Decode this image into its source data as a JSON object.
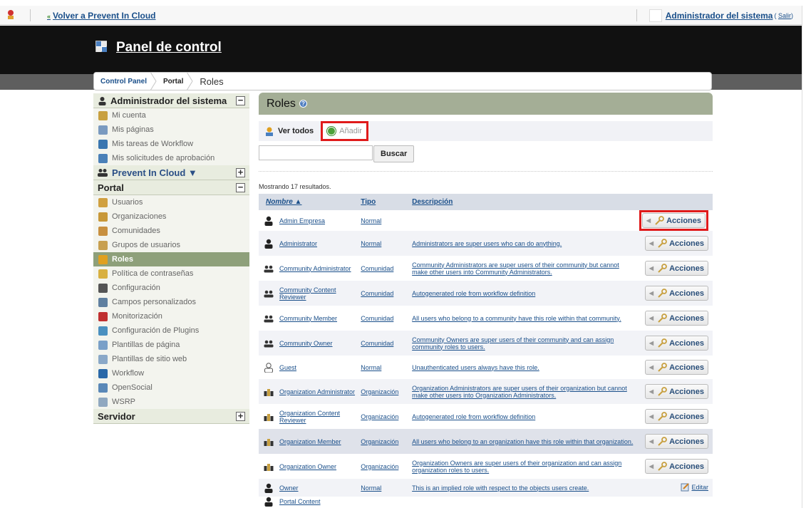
{
  "dockbar": {
    "back_arrow": "«",
    "back_label": "Volver a Prevent In Cloud",
    "user_name": "Administrador del sistema",
    "logout_prefix": "(",
    "logout_label": "Salir",
    "logout_suffix": ")"
  },
  "header": {
    "title": "Panel de control"
  },
  "breadcrumb": [
    "Control Panel",
    "Portal",
    "Roles"
  ],
  "sidebar": {
    "user_section": "Administrador del sistema",
    "user_items": [
      {
        "label": "Mi cuenta",
        "icon": "account-icon",
        "color": "#c8a040"
      },
      {
        "label": "Mis páginas",
        "icon": "pages-icon",
        "color": "#7a9ac0"
      },
      {
        "label": "Mis tareas de Workflow",
        "icon": "workflow-tasks-icon",
        "color": "#3a76b0"
      },
      {
        "label": "Mis solicitudes de aprobación",
        "icon": "approval-icon",
        "color": "#4a80b8"
      }
    ],
    "site_section": "Prevent In Cloud ▼",
    "portal_section": "Portal",
    "portal_items": [
      {
        "label": "Usuarios",
        "icon": "users-icon",
        "color": "#d0a040"
      },
      {
        "label": "Organizaciones",
        "icon": "organizations-icon",
        "color": "#c89838"
      },
      {
        "label": "Comunidades",
        "icon": "communities-icon",
        "color": "#c89040"
      },
      {
        "label": "Grupos de usuarios",
        "icon": "user-groups-icon",
        "color": "#c8a050"
      },
      {
        "label": "Roles",
        "icon": "roles-icon",
        "color": "#e0a020",
        "active": true
      },
      {
        "label": "Política de contraseñas",
        "icon": "password-policy-icon",
        "color": "#d8b040"
      },
      {
        "label": "Configuración",
        "icon": "settings-icon",
        "color": "#555555"
      },
      {
        "label": "Campos personalizados",
        "icon": "custom-fields-icon",
        "color": "#6080a0"
      },
      {
        "label": "Monitorización",
        "icon": "monitoring-icon",
        "color": "#c03030"
      },
      {
        "label": "Configuración de Plugins",
        "icon": "plugins-icon",
        "color": "#4a90c0"
      },
      {
        "label": "Plantillas de página",
        "icon": "page-templates-icon",
        "color": "#7aa0c8"
      },
      {
        "label": "Plantillas de sitio web",
        "icon": "site-templates-icon",
        "color": "#8aa8c8"
      },
      {
        "label": "Workflow",
        "icon": "workflow-icon",
        "color": "#2a68a8"
      },
      {
        "label": "OpenSocial",
        "icon": "opensocial-icon",
        "color": "#5a88b8"
      },
      {
        "label": "WSRP",
        "icon": "wsrp-icon",
        "color": "#90a8c0"
      }
    ],
    "server_section": "Servidor"
  },
  "main": {
    "title": "Roles",
    "help": "?",
    "tab_view_all": "Ver todos",
    "tab_add": "Añadir",
    "search_value": "",
    "search_button": "Buscar",
    "showing": "Mostrando 17 resultados.",
    "columns": [
      "Nombre ▲",
      "Tipo",
      "Descripción"
    ],
    "actions_label": "Acciones",
    "actions_arrow": "◀",
    "edit_label": "Editar",
    "rows": [
      {
        "name": "Admin Empresa",
        "type": "Normal",
        "desc": "",
        "icon": "regular",
        "action": "acciones",
        "highlight": true
      },
      {
        "name": "Administrator",
        "type": "Normal",
        "desc": "Administrators are super users who can do anything.",
        "icon": "regular",
        "action": "acciones"
      },
      {
        "name": "Community Administrator",
        "type": "Comunidad",
        "desc": "Community Administrators are super users of their community but cannot make other users into Community Administrators.",
        "icon": "community",
        "action": "acciones"
      },
      {
        "name": "Community Content Reviewer",
        "type": "Comunidad",
        "desc": "Autogenerated role from workflow definition",
        "icon": "community",
        "action": "acciones"
      },
      {
        "name": "Community Member",
        "type": "Comunidad",
        "desc": "All users who belong to a community have this role within that community.",
        "icon": "community",
        "action": "acciones"
      },
      {
        "name": "Community Owner",
        "type": "Comunidad",
        "desc": "Community Owners are super users of their community and can assign community roles to users.",
        "icon": "community",
        "action": "acciones"
      },
      {
        "name": "Guest",
        "type": "Normal",
        "desc": "Unauthenticated users always have this role.",
        "icon": "guest",
        "action": "acciones"
      },
      {
        "name": "Organization Administrator",
        "type": "Organización",
        "desc": "Organization Administrators are super users of their organization but cannot make other users into Organization Administrators.",
        "icon": "organization",
        "action": "acciones"
      },
      {
        "name": "Organization Content Reviewer",
        "type": "Organización",
        "desc": "Autogenerated role from workflow definition",
        "icon": "organization",
        "action": "acciones"
      },
      {
        "name": "Organization Member",
        "type": "Organización",
        "desc": "All users who belong to an organization have this role within that organization.",
        "icon": "organization",
        "action": "acciones",
        "row_hover": true
      },
      {
        "name": "Organization Owner",
        "type": "Organización",
        "desc": "Organization Owners are super users of their organization and can assign organization roles to users.",
        "icon": "organization",
        "action": "acciones"
      },
      {
        "name": "Owner",
        "type": "Normal",
        "desc": "This is an implied role with respect to the objects users create.",
        "icon": "regular",
        "action": "editar"
      },
      {
        "name": "Portal Content",
        "type": "",
        "desc": "",
        "icon": "regular",
        "action": "",
        "partial": true
      }
    ]
  },
  "colors": {
    "highlight_box": "#e01b1b",
    "title_bar": "#a4ae96",
    "active_nav": "#8ea07a",
    "link": "#1a4f8a"
  }
}
